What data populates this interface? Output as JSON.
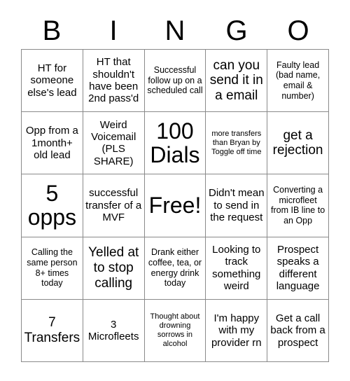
{
  "card": {
    "title": "BINGO",
    "header_letters": [
      "B",
      "I",
      "N",
      "G",
      "O"
    ],
    "columns": 5,
    "rows": 5,
    "colors": {
      "text": "#000000",
      "grid_line": "#8a8a8a",
      "background": "#ffffff"
    },
    "free_space": {
      "label": "Free!",
      "row": 3,
      "column": 3
    },
    "cells": [
      [
        {
          "text": "HT for someone else's lead",
          "size": "md"
        },
        {
          "text": "HT that shouldn't have been 2nd pass'd",
          "size": "md"
        },
        {
          "text": "Successful follow up on a scheduled call",
          "size": "sm"
        },
        {
          "text": "can you send it in a email",
          "size": "lg"
        },
        {
          "text": "Faulty lead (bad name, email & number)",
          "size": "sm"
        }
      ],
      [
        {
          "text": "Opp from a 1month+ old lead",
          "size": "md"
        },
        {
          "text": "Weird Voicemail (PLS SHARE)",
          "size": "md"
        },
        {
          "text": "100 Dials",
          "size": "xxl"
        },
        {
          "text": "more transfers than Bryan by Toggle off time",
          "size": "xs"
        },
        {
          "text": "get a rejection",
          "size": "lg"
        }
      ],
      [
        {
          "text": "5 opps",
          "size": "xxl"
        },
        {
          "text": "successful transfer of a MVF",
          "size": "md"
        },
        {
          "text": "Free!",
          "size": "xxl"
        },
        {
          "text": "Didn't mean to send in the request",
          "size": "md"
        },
        {
          "text": "Converting a microfleet from IB line to an Opp",
          "size": "sm"
        }
      ],
      [
        {
          "text": "Calling the same person 8+ times today",
          "size": "sm"
        },
        {
          "text": "Yelled at to stop calling",
          "size": "lg"
        },
        {
          "text": "Drank either coffee, tea, or energy drink today",
          "size": "sm"
        },
        {
          "text": "Looking to track something weird",
          "size": "md"
        },
        {
          "text": "Prospect speaks a different language",
          "size": "md"
        }
      ],
      [
        {
          "text": "7 Transfers",
          "size": "lg"
        },
        {
          "text": "3 Microfleets",
          "size": "md"
        },
        {
          "text": "Thought about drowning sorrows in alcohol",
          "size": "xs"
        },
        {
          "text": "I'm happy with my provider rn",
          "size": "md"
        },
        {
          "text": "Get a call back from a prospect",
          "size": "md"
        }
      ]
    ]
  }
}
